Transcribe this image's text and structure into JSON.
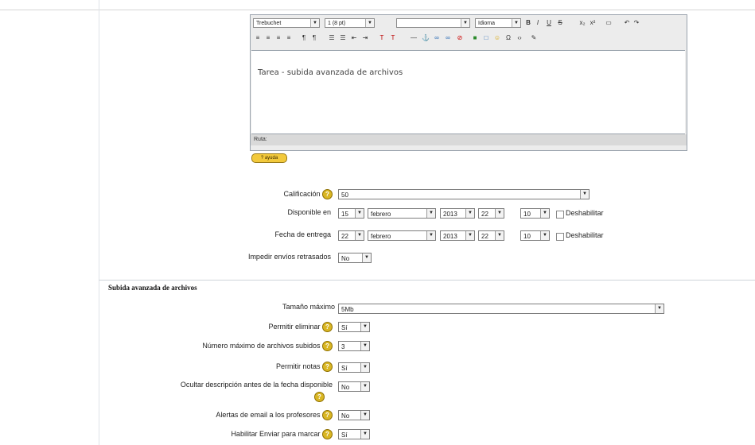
{
  "editor": {
    "font_family": "Trebuchet",
    "font_size": "1 (8 pt)",
    "format_blank": "",
    "language": "Idioma",
    "content": "Tarea - subida avanzada de archivos",
    "path_label": "Ruta:",
    "help_label": "? ayuda",
    "toolbar_icons_row1": [
      "bold-icon",
      "italic-icon",
      "underline-icon",
      "strikethrough-icon",
      "subscript-icon",
      "superscript-icon",
      "paste-icon",
      "undo-icon",
      "redo-icon"
    ],
    "toolbar_icons_row2": [
      "align-left-icon",
      "align-center-icon",
      "align-right-icon",
      "justify-icon",
      "ltr-icon",
      "rtl-icon",
      "ordered-list-icon",
      "unordered-list-icon",
      "outdent-icon",
      "indent-icon",
      "text-color-icon",
      "background-color-icon",
      "hr-icon",
      "anchor-icon",
      "link-icon",
      "unlink-icon",
      "nolink-icon",
      "image-icon",
      "table-icon",
      "smiley-icon",
      "special-char-icon",
      "source-icon",
      "spellcheck-icon"
    ]
  },
  "grading": {
    "label": "Calificación",
    "value": "50"
  },
  "available_from": {
    "label": "Disponible en",
    "day": "15",
    "month": "febrero",
    "year": "2013",
    "hour": "22",
    "minute": "10",
    "disable_label": "Deshabilitar"
  },
  "due_date": {
    "label": "Fecha de entrega",
    "day": "22",
    "month": "febrero",
    "year": "2013",
    "hour": "22",
    "minute": "10",
    "disable_label": "Deshabilitar"
  },
  "prevent_late": {
    "label": "Impedir envíos retrasados",
    "value": "No"
  },
  "section": {
    "title": "Subida avanzada de archivos"
  },
  "max_size": {
    "label": "Tamaño máximo",
    "value": "5Mb"
  },
  "allow_delete": {
    "label": "Permitir eliminar",
    "value": "Sí"
  },
  "max_files": {
    "label": "Número máximo de archivos subidos",
    "value": "3"
  },
  "allow_notes": {
    "label": "Permitir notas",
    "value": "Sí"
  },
  "hide_desc": {
    "label": "Ocultar descripción antes de la fecha disponible",
    "value": "No"
  },
  "email_alerts": {
    "label": "Alertas de email a los profesores",
    "value": "No"
  },
  "enable_send": {
    "label": "Habilitar Enviar para marcar",
    "value": "Sí"
  }
}
